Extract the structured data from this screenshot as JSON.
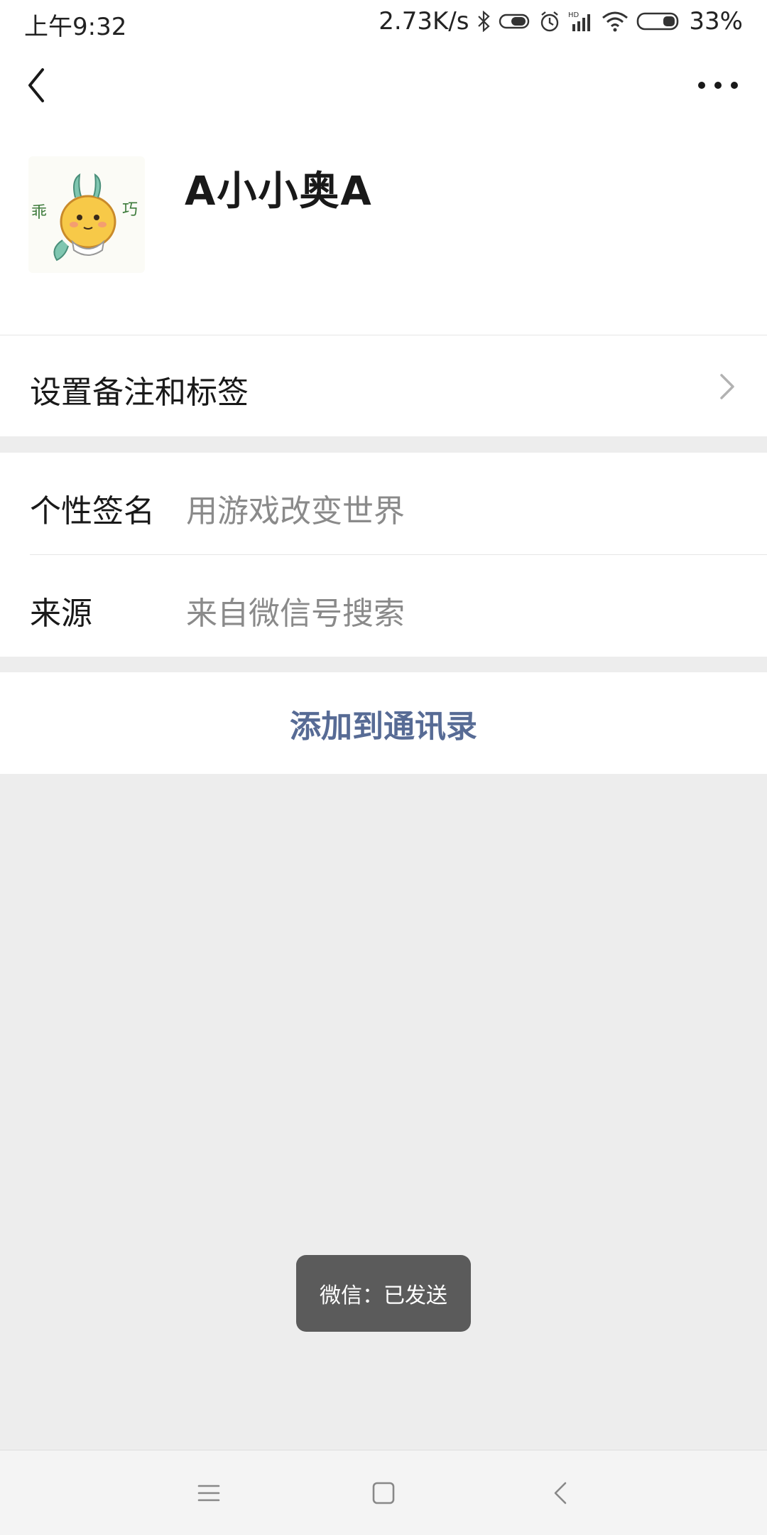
{
  "status_bar": {
    "time": "上午9:32",
    "net_speed": "2.73K/s",
    "battery": "33%",
    "icons": [
      "bluetooth-icon",
      "toggle-icon",
      "alarm-icon",
      "hd-signal-icon",
      "wifi-icon",
      "battery-icon"
    ]
  },
  "nav": {
    "back_icon": "back-chevron-icon",
    "more_icon": "more-dots-icon"
  },
  "profile": {
    "name": "A小小奥A",
    "avatar_icon": "dragon-avatar"
  },
  "remark": {
    "label": "设置备注和标签"
  },
  "info": {
    "rows": [
      {
        "key": "个性签名",
        "value": "用游戏改变世界"
      },
      {
        "key": "来源",
        "value": "来自微信号搜索"
      }
    ]
  },
  "actions": {
    "add_contact": "添加到通讯录"
  },
  "toast": {
    "text": "微信：已发送"
  },
  "colors": {
    "background": "#ededed",
    "link_blue": "#576b95",
    "toast_bg": "#5b5b5b"
  }
}
